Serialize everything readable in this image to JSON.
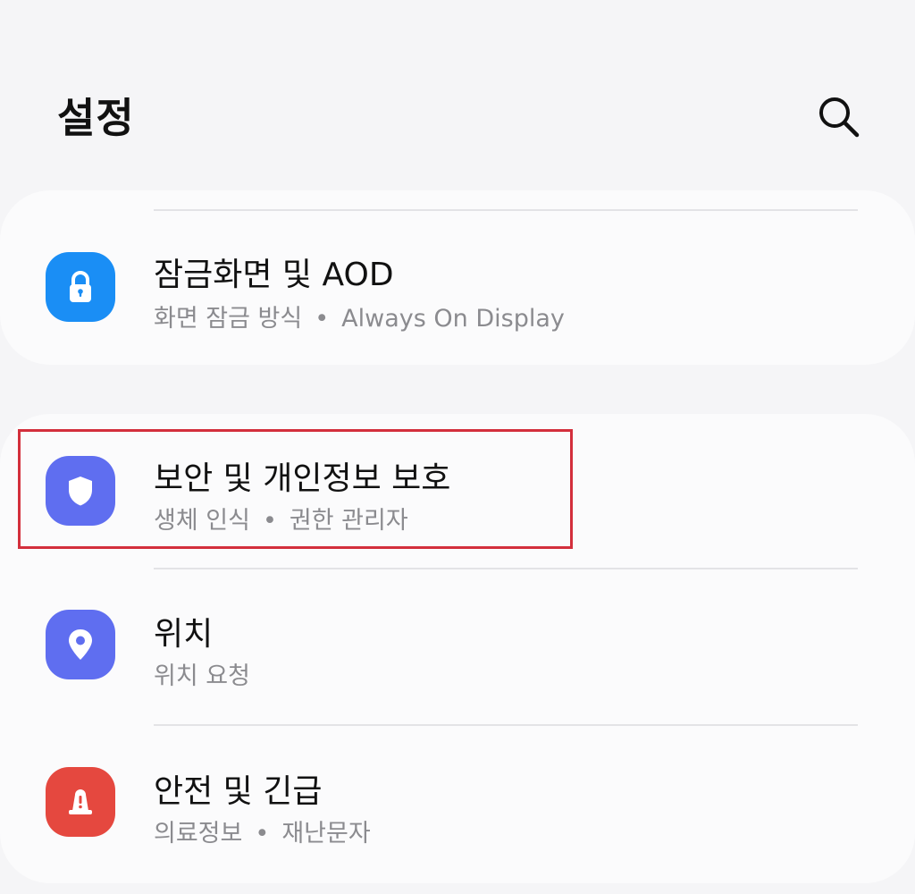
{
  "header": {
    "title": "설정",
    "search_icon": "search-icon"
  },
  "items": [
    {
      "title": "잠금화면 및 AOD",
      "subtitle_parts": [
        "화면 잠금 방식",
        "Always On Display"
      ],
      "icon": "lock-icon",
      "icon_color": "#1a8ef5"
    },
    {
      "title": "보안 및 개인정보 보호",
      "subtitle_parts": [
        "생체 인식",
        "권한 관리자"
      ],
      "icon": "shield-icon",
      "icon_color": "#5f6ef0",
      "highlighted": true
    },
    {
      "title": "위치",
      "subtitle_parts": [
        "위치 요청"
      ],
      "icon": "location-pin-icon",
      "icon_color": "#5f6ef0"
    },
    {
      "title": "안전 및 긴급",
      "subtitle_parts": [
        "의료정보",
        "재난문자"
      ],
      "icon": "emergency-alert-icon",
      "icon_color": "#e5483f"
    }
  ],
  "separator": "•",
  "highlight_color": "#d32f3c"
}
